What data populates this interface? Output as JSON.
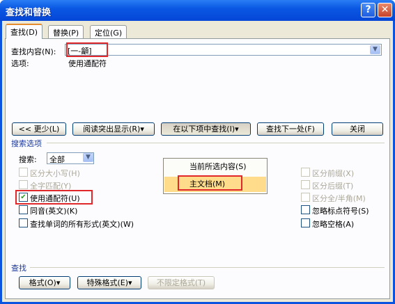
{
  "window": {
    "title": "查找和替换",
    "help": "?",
    "close": "✕"
  },
  "tabs": [
    {
      "label": "查找(D)"
    },
    {
      "label": "替换(P)"
    },
    {
      "label": "定位(G)"
    }
  ],
  "find": {
    "label": "查找内容(N):",
    "value": "[一-龥]"
  },
  "options": {
    "label": "选项:",
    "value": "使用通配符"
  },
  "buttons": {
    "less": "<< 更少(L)",
    "reading_highlight": "阅读突出显示(R)▾",
    "find_in": "在以下项中查找(I)▾",
    "find_next": "查找下一处(F)",
    "close": "关闭"
  },
  "menu": {
    "items": [
      "当前所选内容(S)",
      "主文档(M)"
    ]
  },
  "search_options": {
    "title": "搜索选项",
    "search_label": "搜索:",
    "search_value": "全部"
  },
  "checks_left": [
    {
      "label": "区分大小写(H)",
      "checked": "",
      "disabled": true
    },
    {
      "label": "全字匹配(Y)",
      "checked": "",
      "disabled": true
    },
    {
      "label": "使用通配符(U)",
      "checked": "✔",
      "disabled": false
    },
    {
      "label": "同音(英文)(K)",
      "checked": "",
      "disabled": false
    },
    {
      "label": "查找单词的所有形式(英文)(W)",
      "checked": "",
      "disabled": false
    }
  ],
  "checks_right": [
    {
      "label": "区分前缀(X)",
      "checked": "",
      "disabled": true
    },
    {
      "label": "区分后缀(T)",
      "checked": "",
      "disabled": true
    },
    {
      "label": "区分全/半角(M)",
      "checked": "",
      "disabled": true
    },
    {
      "label": "忽略标点符号(S)",
      "checked": "",
      "disabled": false
    },
    {
      "label": "忽略空格(A)",
      "checked": "",
      "disabled": false
    }
  ],
  "find_section": {
    "title": "查找"
  },
  "bottom_buttons": {
    "format": "格式(O)▾",
    "special": "特殊格式(E)▾",
    "no_format": "不限定格式(T)"
  }
}
